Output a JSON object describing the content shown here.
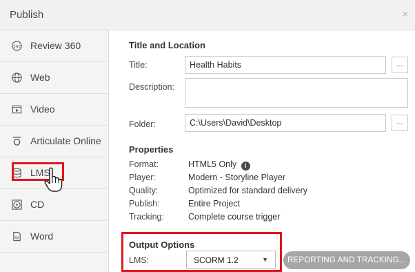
{
  "dialog": {
    "title": "Publish",
    "close_glyph": "×"
  },
  "sidebar": {
    "items": [
      {
        "label": "Review 360",
        "icon": "review-360-icon",
        "selected": false
      },
      {
        "label": "Web",
        "icon": "globe-icon",
        "selected": false
      },
      {
        "label": "Video",
        "icon": "video-icon",
        "selected": false
      },
      {
        "label": "Articulate Online",
        "icon": "articulate-online-icon",
        "selected": false
      },
      {
        "label": "LMS",
        "icon": "database-icon",
        "selected": true
      },
      {
        "label": "CD",
        "icon": "cd-icon",
        "selected": false
      },
      {
        "label": "Word",
        "icon": "word-icon",
        "selected": false
      }
    ]
  },
  "title_location": {
    "heading": "Title and Location",
    "title_label": "Title:",
    "title_value": "Health Habits",
    "description_label": "Description:",
    "description_value": "",
    "folder_label": "Folder:",
    "folder_value": "C:\\Users\\David\\Desktop",
    "browse_label": "..."
  },
  "properties": {
    "heading": "Properties",
    "format_label": "Format:",
    "format_value": "HTML5 Only",
    "player_label": "Player:",
    "player_value": "Modern - Storyline Player",
    "quality_label": "Quality:",
    "quality_value": "Optimized for standard delivery",
    "publish_label": "Publish:",
    "publish_value": "Entire Project",
    "tracking_label": "Tracking:",
    "tracking_value": "Complete course trigger"
  },
  "output_options": {
    "heading": "Output Options",
    "lms_label": "LMS:",
    "lms_value": "SCORM 1.2",
    "reporting_button": "REPORTING AND TRACKING..."
  },
  "colors": {
    "highlight": "#e1141e",
    "disabled_button": "#a6a6a6",
    "sidebar_bg": "#f4f4f4"
  }
}
